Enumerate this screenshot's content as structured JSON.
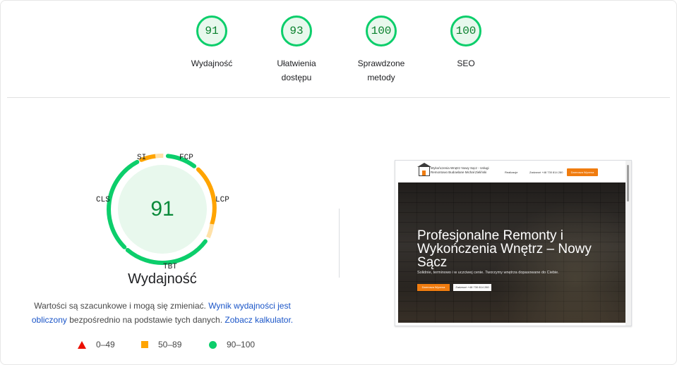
{
  "categories": [
    {
      "score": "91",
      "label": "Wydajność"
    },
    {
      "score": "93",
      "label": "Ułatwienia dostępu"
    },
    {
      "score": "100",
      "label": "Sprawdzone metody"
    },
    {
      "score": "100",
      "label": "SEO"
    }
  ],
  "performance": {
    "score": "91",
    "title": "Wydajność",
    "metrics": {
      "si": "SI",
      "fcp": "FCP",
      "lcp": "LCP",
      "tbt": "TBT",
      "cls": "CLS"
    }
  },
  "note": {
    "text1": "Wartości są szacunkowe i mogą się zmieniać.",
    "link1": "Wynik wydajności jest obliczony",
    "text2": "bezpośrednio na podstawie tych danych.",
    "link2": "Zobacz kalkulator."
  },
  "legend": {
    "fail": "0–49",
    "average": "50–89",
    "pass": "90–100"
  },
  "colors": {
    "pass": "#0cce6b",
    "average": "#ffa400",
    "fail": "#eb0f00",
    "link": "#1a55c8"
  },
  "screenshot": {
    "brand": "Wykończenia Wnętrz Nowy Sącz - Usługi Remontowo Budowlane Michał Zieliński",
    "menu": "Realizacje",
    "phone": "Zadzwoń +48 730 814 280",
    "cta": "Darmowa Wycena",
    "headline": "Profesjonalne Remonty i Wykończenia Wnętrz – Nowy Sącz",
    "subheadline": "Solidnie, terminowo i w uczciwej cenie. Tworzymy wnętrza dopasowane do Ciebie.",
    "btn_primary": "Darmowa Wycena",
    "btn_secondary": "Zadzwoń +48 730 814 280"
  }
}
